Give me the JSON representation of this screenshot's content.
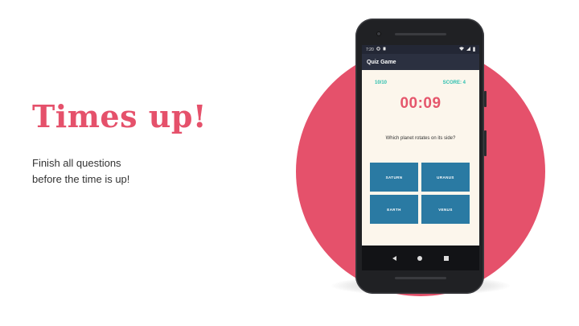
{
  "slide": {
    "headline": "Times up!",
    "subtext_lines": [
      "Finish all questions",
      "before the time is up!"
    ]
  },
  "colors": {
    "accent": "#e5516b",
    "teal": "#2bbfae",
    "answer_bg": "#2a7aa3",
    "app_bar": "#2b3040",
    "screen_bg": "#fcf6ec"
  },
  "phone": {
    "status": {
      "time": "7:20",
      "left_icons": [
        "settings-icon",
        "notification-icon"
      ],
      "right_icons": [
        "wifi-icon",
        "signal-icon",
        "battery-icon"
      ]
    },
    "app": {
      "title": "Quiz Game",
      "progress": "10/10",
      "score": "SCORE: 4",
      "timer": "00:09",
      "question": "Which planet rotates on its side?",
      "answers": [
        "SATURN",
        "URANUS",
        "EARTH",
        "VENUS"
      ]
    },
    "nav": [
      "back-icon",
      "home-icon",
      "recent-apps-icon"
    ]
  }
}
